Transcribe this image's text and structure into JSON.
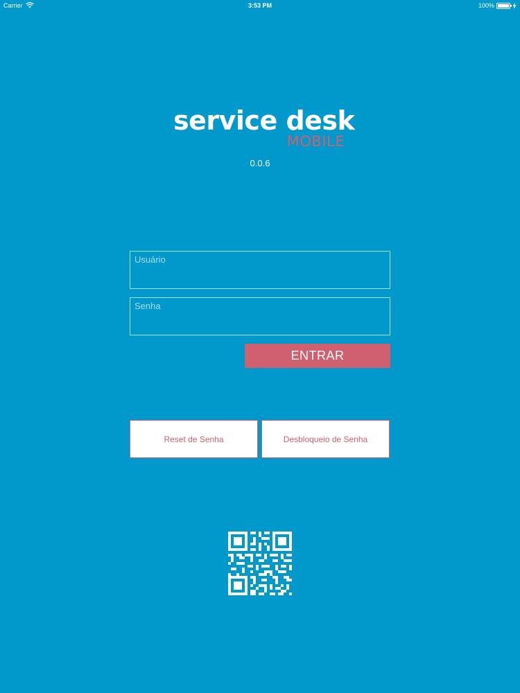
{
  "status_bar": {
    "carrier": "Carrier",
    "time": "3:53 PM",
    "battery": "100%",
    "icons": [
      "wifi-icon",
      "battery-icon",
      "charging-bolt-icon"
    ]
  },
  "logo": {
    "main_text": "service desk",
    "sub_text": "MOBILE"
  },
  "version": "0.0.6",
  "form": {
    "username_placeholder": "Usuário",
    "password_placeholder": "Senha",
    "username_value": "",
    "password_value": "",
    "submit_label": "ENTRAR"
  },
  "actions": {
    "reset_label": "Reset de Senha",
    "unlock_label": "Desbloqueio de Senha"
  },
  "qr": {
    "icon": "qr-code-icon"
  },
  "colors": {
    "background": "#0198cc",
    "accent": "#d06070",
    "field_border": "#a8dff2",
    "text": "#ffffff"
  }
}
